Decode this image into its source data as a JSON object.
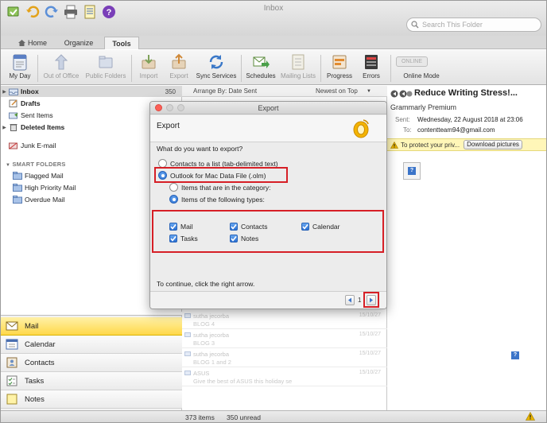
{
  "window": {
    "title": "Inbox"
  },
  "search": {
    "placeholder": "Search This Folder"
  },
  "ribbon_tabs": [
    {
      "label": "Home",
      "active": false
    },
    {
      "label": "Organize",
      "active": false
    },
    {
      "label": "Tools",
      "active": true
    }
  ],
  "toolbar": {
    "my_day": "My Day",
    "out_of_office": "Out of Office",
    "public_folders": "Public Folders",
    "import": "Import",
    "export": "Export",
    "sync_services": "Sync Services",
    "schedules": "Schedules",
    "mailing_lists": "Mailing Lists",
    "progress": "Progress",
    "errors": "Errors",
    "online_badge": "ONLINE",
    "online_mode": "Online Mode"
  },
  "folders": [
    {
      "label": "Inbox",
      "count": "350"
    },
    {
      "label": "Drafts",
      "count": ""
    },
    {
      "label": "Sent Items",
      "count": ""
    },
    {
      "label": "Deleted Items",
      "count": ""
    },
    {
      "label": "Junk E-mail",
      "count": ""
    }
  ],
  "smart_folders": {
    "header": "SMART FOLDERS",
    "items": [
      "Flagged Mail",
      "High Priority Mail",
      "Overdue Mail"
    ]
  },
  "nav": [
    "Mail",
    "Calendar",
    "Contacts",
    "Tasks",
    "Notes"
  ],
  "message_list": {
    "arrange_by": "Arrange By: Date Sent",
    "sort": "Newest on Top",
    "rows": [
      {
        "from": "sutha jecorba",
        "subject": "BLOG 4",
        "date": "15/10/27"
      },
      {
        "from": "sutha jecorba",
        "subject": "BLOG 3",
        "date": "15/10/27"
      },
      {
        "from": "sutha jecorba",
        "subject": "BLOG 1 and 2",
        "date": "15/10/27"
      },
      {
        "from": "ASUS",
        "subject": "Give the best of ASUS this holiday se",
        "date": "15/10/27"
      }
    ]
  },
  "reading_pane": {
    "subject": "Reduce Writing Stress!...",
    "from": "Grammarly Premium",
    "sent_label": "Sent:",
    "sent_value": "Wednesday, 22 August 2018 at 23:06",
    "to_label": "To:",
    "to_value": "contentteam94@gmail.com",
    "privacy_text": "To protect your priv...",
    "download_label": "Download pictures"
  },
  "status": {
    "items": "373 items",
    "unread": "350 unread"
  },
  "dialog": {
    "title": "Export",
    "header": "Export",
    "question": "What do you want to export?",
    "option_contacts": "Contacts to a list (tab-delimited text)",
    "option_olm": "Outlook for Mac Data File (.olm)",
    "option_category": "Items that are in the category:",
    "option_types": "Items of the following types:",
    "checkboxes": {
      "mail": "Mail",
      "contacts": "Contacts",
      "calendar": "Calendar",
      "tasks": "Tasks",
      "notes": "Notes"
    },
    "continue_text": "To continue, click the right arrow.",
    "page": "1"
  },
  "colors": {
    "highlight": "#d61f26",
    "accent_blue": "#2a6fd2",
    "nav_active": "#ffd84a"
  }
}
